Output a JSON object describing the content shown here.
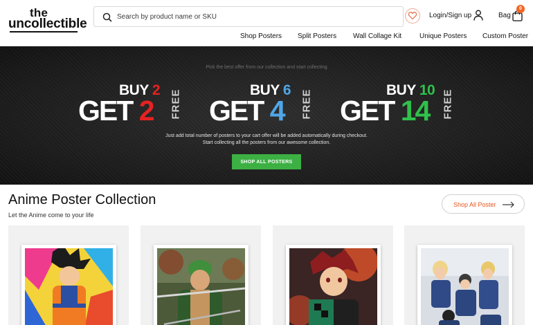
{
  "brand": {
    "logo_line1": "the",
    "logo_line2": "uncollectible"
  },
  "search": {
    "placeholder": "Search by product name or SKU"
  },
  "account": {
    "login_label": "Login/Sign up"
  },
  "bag": {
    "label": "Bag",
    "count": "0"
  },
  "nav": {
    "items": [
      "Shop Posters",
      "Split Posters",
      "Wall Collage Kit",
      "Unique Posters",
      "Custom Poster"
    ]
  },
  "banner": {
    "subtitle": "Pick the best offer from our collection and start collecting",
    "offers": [
      {
        "buy_word": "BUY",
        "buy_num": "2",
        "get_word": "GET",
        "get_num": "2",
        "free": "FREE",
        "accent": "#e52222"
      },
      {
        "buy_word": "BUY",
        "buy_num": "6",
        "get_word": "GET",
        "get_num": "4",
        "free": "FREE",
        "accent": "#4fa6e8"
      },
      {
        "buy_word": "BUY",
        "buy_num": "10",
        "get_word": "GET",
        "get_num": "14",
        "free": "FREE",
        "accent": "#2fc14b"
      }
    ],
    "desc_line1": "Just add total number of posters to your cart offer will be added automatically during checkout.",
    "desc_line2": "Start collecting all the posters from our awesome collection.",
    "cta": "SHOP ALL POSTERS"
  },
  "section": {
    "title": "Anime Poster Collection",
    "subtitle": "Let the Anime come to your life",
    "shop_all": "Shop All Poster"
  },
  "colors": {
    "accent_orange": "#f26522",
    "cta_green": "#3cb043",
    "banner_bg": "#1c1c1c"
  },
  "icons": [
    "search-icon",
    "heart-icon",
    "user-icon",
    "bag-icon",
    "arrow-right-icon"
  ]
}
